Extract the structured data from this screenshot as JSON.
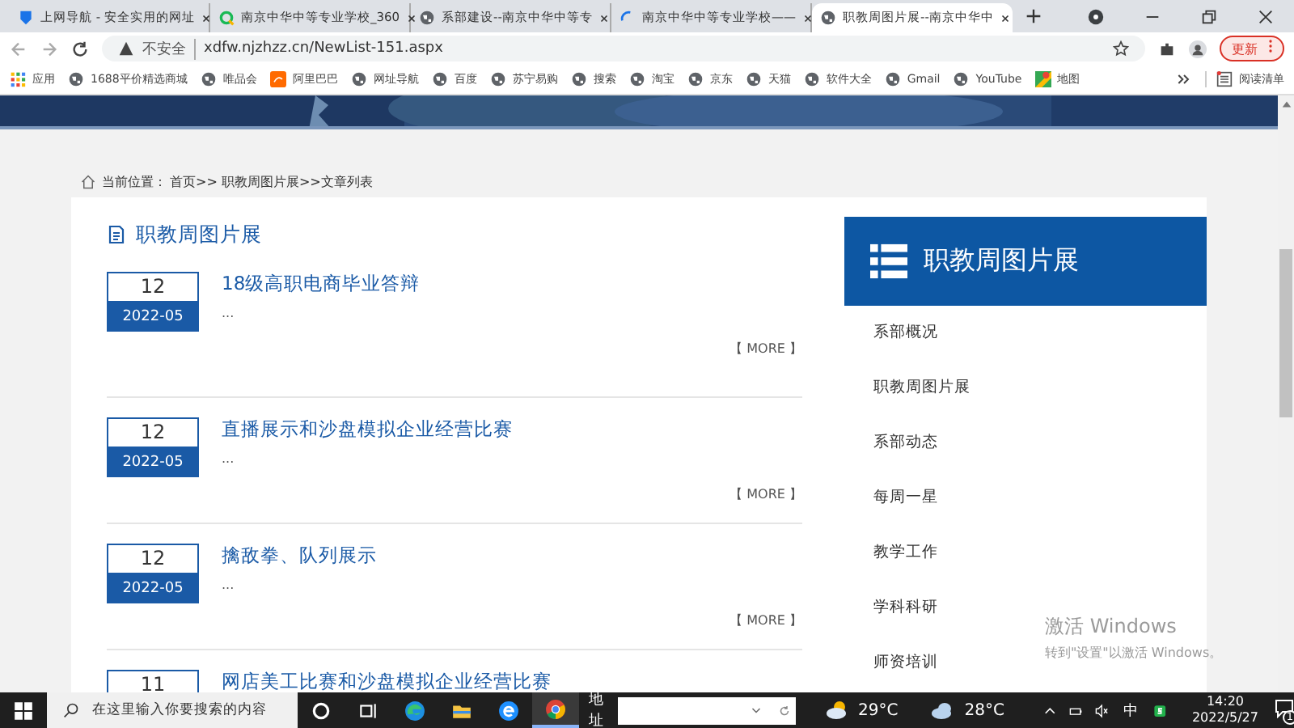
{
  "tabs": [
    {
      "title": "上网导航 - 安全实用的网址",
      "selected": false
    },
    {
      "title": "南京中华中等专业学校_360",
      "selected": false
    },
    {
      "title": "系部建设--南京中华中等专",
      "selected": false
    },
    {
      "title": "南京中华中等专业学校——",
      "selected": false
    },
    {
      "title": "职教周图片展--南京中华中",
      "selected": true
    }
  ],
  "address_bar": {
    "security": "不安全",
    "url": "xdfw.njzhzz.cn/NewList-151.aspx",
    "update_button": "更新"
  },
  "bookmarks": [
    "应用",
    "1688平价精选商城",
    "唯品会",
    "阿里巴巴",
    "网址导航",
    "百度",
    "苏宁易购",
    "搜索",
    "淘宝",
    "京东",
    "天猫",
    "软件大全",
    "Gmail",
    "YouTube",
    "地图"
  ],
  "reading_list": "阅读清单",
  "breadcrumb": {
    "label": "当前位置：",
    "path": "首页>> 职教周图片展>>文章列表"
  },
  "section_title": "职教周图片展",
  "articles": [
    {
      "day": "12",
      "month": "2022-05",
      "title": "18级高职电商毕业答辩",
      "excerpt": "...",
      "more": "【 MORE 】"
    },
    {
      "day": "12",
      "month": "2022-05",
      "title": "直播展示和沙盘模拟企业经营比赛",
      "excerpt": "...",
      "more": "【 MORE 】"
    },
    {
      "day": "12",
      "month": "2022-05",
      "title": "擒敌拳、队列展示",
      "excerpt": "...",
      "more": "【 MORE 】"
    },
    {
      "day": "11",
      "title": "网店美工比赛和沙盘模拟企业经营比赛"
    }
  ],
  "sidebar": {
    "title": "职教周图片展",
    "items": [
      "系部概况",
      "职教周图片展",
      "系部动态",
      "每周一星",
      "教学工作",
      "学科科研",
      "师资培训"
    ]
  },
  "activation": {
    "title": "激活 Windows",
    "hint": "转到\"设置\"以激活 Windows。"
  },
  "taskbar": {
    "search_placeholder": "在这里输入你要搜索的内容",
    "address_label": "地址",
    "weather": [
      "29°C",
      "28°C"
    ],
    "ime": "中",
    "time": "14:20",
    "date": "2022/5/27",
    "notifications": "1"
  }
}
